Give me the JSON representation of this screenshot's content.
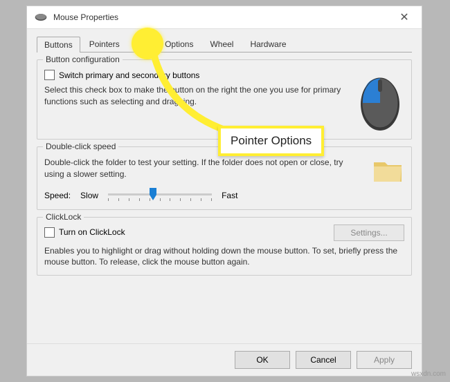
{
  "window": {
    "title": "Mouse Properties",
    "close": "✕"
  },
  "tabs": [
    "Buttons",
    "Pointers",
    "Pointer Options",
    "Wheel",
    "Hardware"
  ],
  "groups": {
    "buttonConfig": {
      "title": "Button configuration",
      "checkbox": "Switch primary and secondary buttons",
      "desc": "Select this check box to make the button on the right the one you use for primary functions such as selecting and dragging."
    },
    "doubleClick": {
      "title": "Double-click speed",
      "desc": "Double-click the folder to test your setting. If the folder does not open or close, try using a slower setting.",
      "speedLabel": "Speed:",
      "slow": "Slow",
      "fast": "Fast"
    },
    "clickLock": {
      "title": "ClickLock",
      "checkbox": "Turn on ClickLock",
      "settings": "Settings...",
      "desc": "Enables you to highlight or drag without holding down the mouse button. To set, briefly press the mouse button. To release, click the mouse button again."
    }
  },
  "buttons": {
    "ok": "OK",
    "cancel": "Cancel",
    "apply": "Apply"
  },
  "callout": "Pointer Options",
  "watermark": "wsxdn.com"
}
